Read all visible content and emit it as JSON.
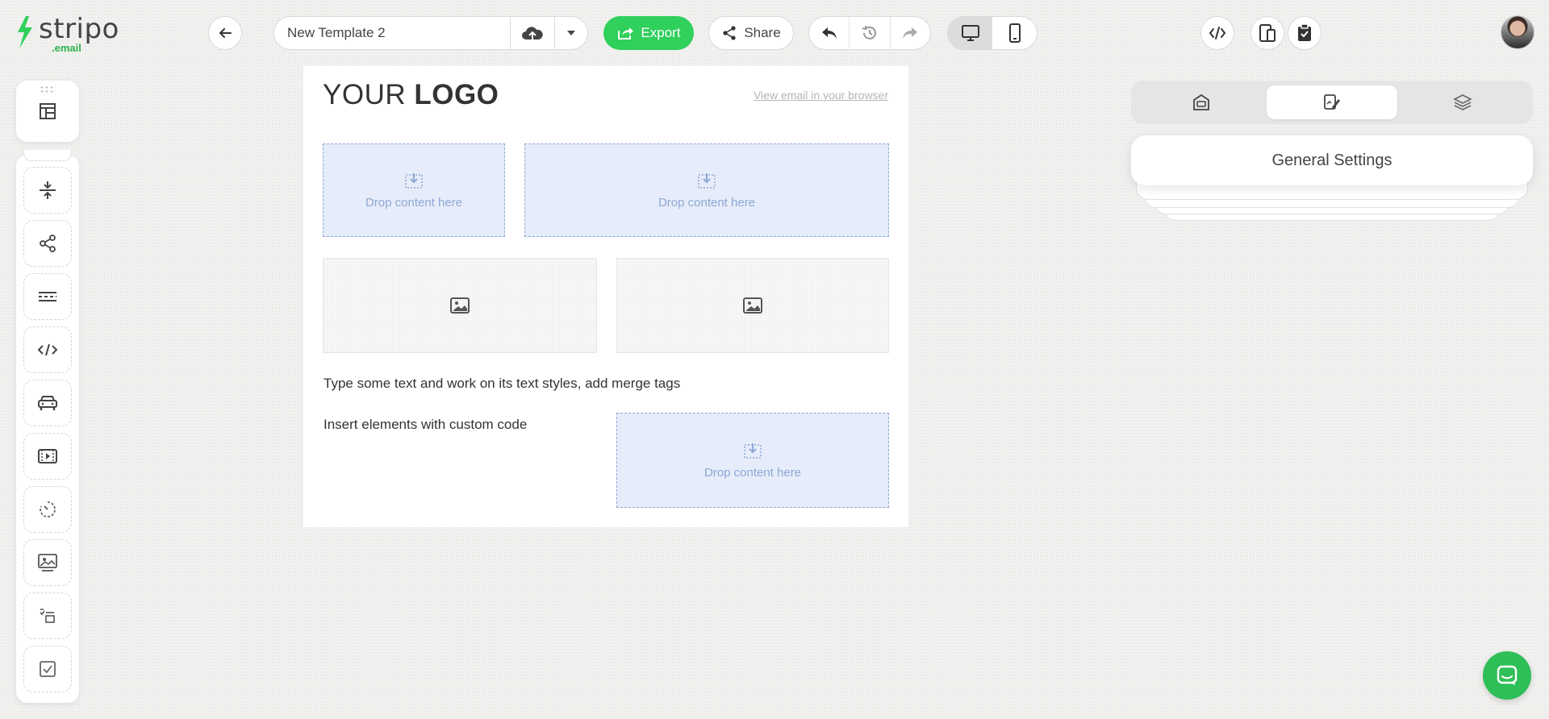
{
  "app": {
    "logo_text": "stripo",
    "logo_sub": ".email",
    "brand_color": "#2fd05c"
  },
  "header": {
    "back_icon": "arrow-left-icon",
    "template_name": "New Template 2",
    "save_icon": "cloud-upload-icon",
    "dropdown_icon": "caret-down-icon",
    "export_label": "Export",
    "share_label": "Share",
    "history_icons": [
      "undo-icon",
      "history-icon",
      "redo-icon"
    ],
    "device_icons": [
      "desktop-icon",
      "mobile-icon"
    ],
    "active_device": "desktop",
    "right_icons": [
      "code-icon",
      "responsive-preview-icon",
      "clipboard-check-icon"
    ]
  },
  "sidebar": {
    "top_icon": "blocks-icon",
    "tools": [
      "spacer-icon",
      "social-share-icon",
      "divider-icon",
      "html-code-icon",
      "amp-carousel-icon",
      "video-icon",
      "timer-icon",
      "banner-icon",
      "amp-form-icon",
      "checkbox-icon"
    ]
  },
  "canvas": {
    "logo_prefix": "YOUR ",
    "logo_bold": "LOGO",
    "view_link": "View email in your browser",
    "drop_label": "Drop content here",
    "text_line": "Type some text and work on its text styles, add merge tags",
    "custom_code_text": "Insert elements with custom code"
  },
  "panel": {
    "tabs": [
      "appearance-icon",
      "style-icon",
      "layers-icon"
    ],
    "active_tab": 1,
    "general_settings": "General Settings"
  },
  "chat": {
    "icon": "chat-icon"
  }
}
